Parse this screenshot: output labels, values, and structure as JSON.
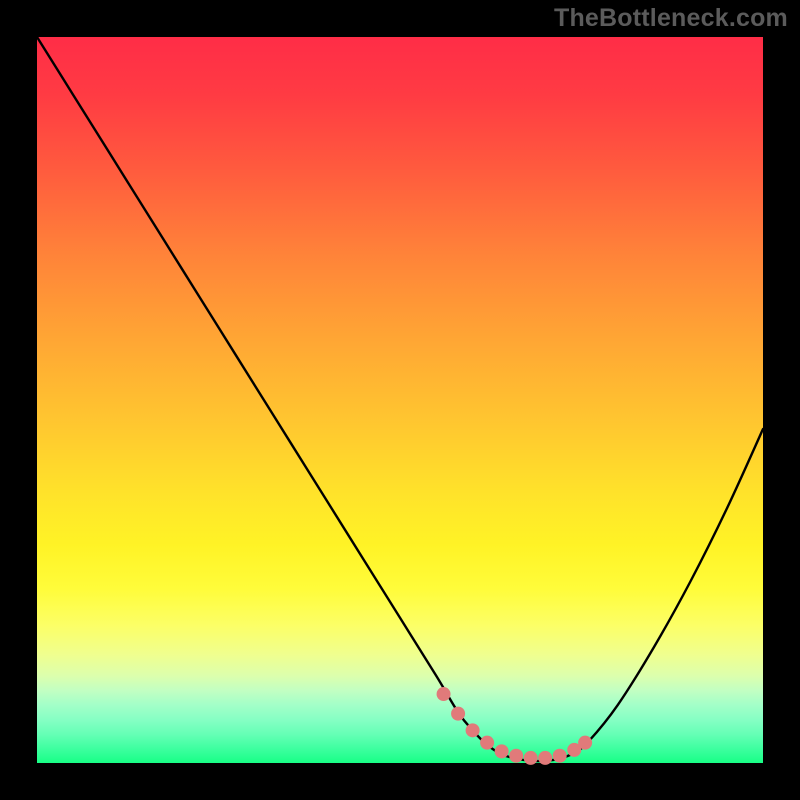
{
  "branding": {
    "watermark": "TheBottleneck.com"
  },
  "chart_data": {
    "type": "line",
    "title": "",
    "xlabel": "",
    "ylabel": "",
    "xlim": [
      0,
      100
    ],
    "ylim": [
      0,
      100
    ],
    "grid": false,
    "series": [
      {
        "name": "bottleneck-curve",
        "x": [
          0,
          5,
          10,
          15,
          20,
          25,
          30,
          35,
          40,
          45,
          50,
          55,
          58,
          60,
          62,
          64,
          66,
          68,
          70,
          72,
          74,
          76,
          80,
          85,
          90,
          95,
          100
        ],
        "values": [
          100,
          92,
          84,
          76,
          68,
          60,
          52,
          44,
          36,
          28,
          20,
          12,
          7,
          4.5,
          2.5,
          1.2,
          0.6,
          0.3,
          0.3,
          0.6,
          1.4,
          3.0,
          8.0,
          16,
          25,
          35,
          46
        ]
      }
    ],
    "markers": {
      "name": "highlight-dots",
      "color": "#e17a7a",
      "points_xy": [
        [
          56,
          9.5
        ],
        [
          58,
          6.8
        ],
        [
          60,
          4.5
        ],
        [
          62,
          2.8
        ],
        [
          64,
          1.6
        ],
        [
          66,
          1.0
        ],
        [
          68,
          0.7
        ],
        [
          70,
          0.7
        ],
        [
          72,
          1.0
        ],
        [
          74,
          1.8
        ],
        [
          75.5,
          2.8
        ]
      ]
    },
    "background": {
      "style": "vertical-gradient",
      "top_color": "#ff2d47",
      "mid_color": "#fff326",
      "bottom_color": "#18ff86"
    }
  }
}
